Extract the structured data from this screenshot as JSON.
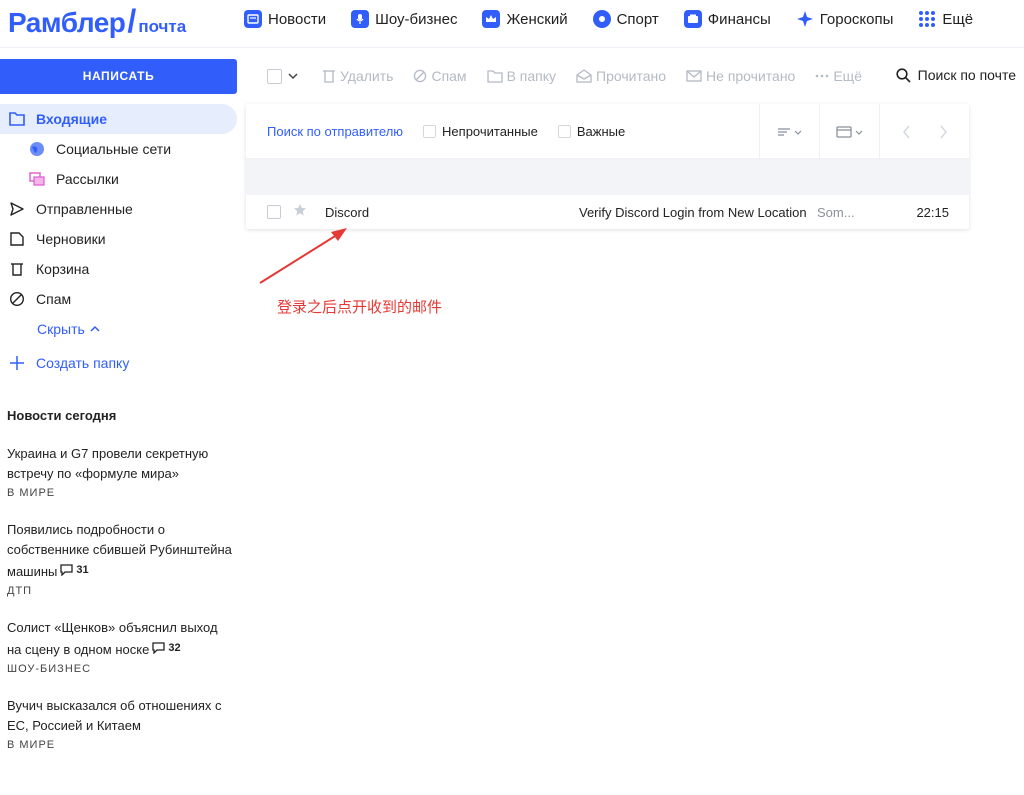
{
  "header": {
    "logo_main": "Рамблер",
    "logo_slash": "/",
    "logo_sub": "почта",
    "nav": [
      {
        "label": "Новости",
        "icon": "news-icon",
        "color": "#315efb"
      },
      {
        "label": "Шоу-бизнес",
        "icon": "microphone-icon",
        "color": "#315efb"
      },
      {
        "label": "Женский",
        "icon": "crown-icon",
        "color": "#315efb"
      },
      {
        "label": "Спорт",
        "icon": "ball-icon",
        "color": "#315efb"
      },
      {
        "label": "Финансы",
        "icon": "wallet-icon",
        "color": "#315efb"
      },
      {
        "label": "Гороскопы",
        "icon": "star-icon",
        "color": "#315efb"
      },
      {
        "label": "Ещё",
        "icon": "grid-icon",
        "color": "#315efb"
      }
    ]
  },
  "sidebar": {
    "compose_label": "НАПИСАТЬ",
    "folders": [
      {
        "label": "Входящие",
        "icon": "inbox-icon",
        "active": true
      },
      {
        "label": "Социальные сети",
        "icon": "globe-icon",
        "sub": true
      },
      {
        "label": "Рассылки",
        "icon": "mailing-icon",
        "sub": true
      },
      {
        "label": "Отправленные",
        "icon": "send-icon"
      },
      {
        "label": "Черновики",
        "icon": "draft-icon"
      },
      {
        "label": "Корзина",
        "icon": "trash-icon"
      },
      {
        "label": "Спам",
        "icon": "spam-icon"
      }
    ],
    "hide_label": "Скрыть",
    "create_folder_label": "Создать папку"
  },
  "news": {
    "title": "Новости сегодня",
    "items": [
      {
        "text": "Украина и G7 провели секретную встречу по «формуле мира»",
        "category": "В МИРЕ",
        "comments": ""
      },
      {
        "text": "Появились подробности о собственнике сбившей Рубинштейна машины",
        "category": "ДТП",
        "comments": "31"
      },
      {
        "text": "Солист «Щенков» объяснил выход на сцену в одном носке",
        "category": "ШОУ-БИЗНЕС",
        "comments": "32"
      },
      {
        "text": "Вучич высказался об отношениях с ЕС, Россией и Китаем",
        "category": "В МИРЕ",
        "comments": ""
      }
    ]
  },
  "toolbar": {
    "delete_label": "Удалить",
    "spam_label": "Спам",
    "move_label": "В папку",
    "read_label": "Прочитано",
    "unread_label": "Не прочитано",
    "more_label": "Ещё",
    "search_label": "Поиск по почте"
  },
  "filter": {
    "sender_search": "Поиск по отправителю",
    "unread": "Непрочитанные",
    "important": "Важные"
  },
  "mail": {
    "rows": [
      {
        "sender": "Discord",
        "subject": "Verify Discord Login from New Location",
        "preview": "Som...",
        "time": "22:15"
      }
    ]
  },
  "annotation": {
    "text": "登录之后点开收到的邮件",
    "color": "#e53935"
  }
}
